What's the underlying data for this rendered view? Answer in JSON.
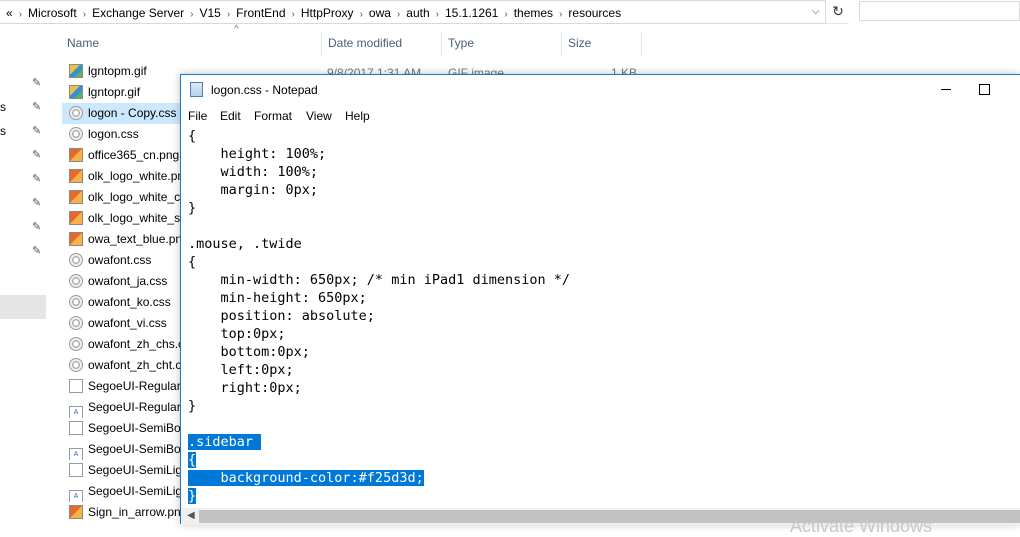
{
  "address": {
    "overflow": "«",
    "crumbs": [
      "Microsoft",
      "Exchange Server",
      "V15",
      "FrontEnd",
      "HttpProxy",
      "owa",
      "auth",
      "15.1.1261",
      "themes",
      "resources"
    ],
    "separator": "›",
    "dropdown_glyph": "⌵",
    "refresh_glyph": "↻"
  },
  "nav_fragments": [
    "s",
    "s"
  ],
  "columns": {
    "name": "Name",
    "date": "Date modified",
    "type": "Type",
    "size": "Size",
    "sort_glyph": "^"
  },
  "files": [
    {
      "name": "lgntopm.gif",
      "icon": "gif"
    },
    {
      "name": "lgntopr.gif",
      "icon": "gif"
    },
    {
      "name": "logon - Copy.css",
      "icon": "css",
      "selected": true
    },
    {
      "name": "logon.css",
      "icon": "css"
    },
    {
      "name": "office365_cn.png",
      "icon": "png"
    },
    {
      "name": "olk_logo_white.pn",
      "icon": "png"
    },
    {
      "name": "olk_logo_white_c",
      "icon": "png"
    },
    {
      "name": "olk_logo_white_s",
      "icon": "png"
    },
    {
      "name": "owa_text_blue.pn",
      "icon": "png"
    },
    {
      "name": "owafont.css",
      "icon": "css"
    },
    {
      "name": "owafont_ja.css",
      "icon": "css"
    },
    {
      "name": "owafont_ko.css",
      "icon": "css"
    },
    {
      "name": "owafont_vi.css",
      "icon": "css"
    },
    {
      "name": "owafont_zh_chs.c",
      "icon": "css"
    },
    {
      "name": "owafont_zh_cht.c",
      "icon": "css"
    },
    {
      "name": "SegoeUI-Regular.",
      "icon": "blank"
    },
    {
      "name": "SegoeUI-Regular.",
      "icon": "font"
    },
    {
      "name": "SegoeUI-SemiBol",
      "icon": "blank"
    },
    {
      "name": "SegoeUI-SemiBol",
      "icon": "font"
    },
    {
      "name": "SegoeUI-SemiLig",
      "icon": "blank"
    },
    {
      "name": "SegoeUI-SemiLig",
      "icon": "font"
    },
    {
      "name": "Sign_in_arrow.png",
      "icon": "png"
    }
  ],
  "hidden_row": {
    "date": "9/8/2017 1:31 AM",
    "type": "GIF image",
    "size": "1 KB"
  },
  "notepad": {
    "title": "logon.css - Notepad",
    "menu": [
      "File",
      "Edit",
      "Format",
      "View",
      "Help"
    ],
    "lines": [
      {
        "text": "{",
        "hl": false
      },
      {
        "text": "    height: 100%;",
        "hl": false
      },
      {
        "text": "    width: 100%;",
        "hl": false
      },
      {
        "text": "    margin: 0px;",
        "hl": false
      },
      {
        "text": "}",
        "hl": false
      },
      {
        "text": "",
        "hl": false
      },
      {
        "text": ".mouse, .twide",
        "hl": false
      },
      {
        "text": "{",
        "hl": false
      },
      {
        "text": "    min-width: 650px; /* min iPad1 dimension */",
        "hl": false
      },
      {
        "text": "    min-height: 650px;",
        "hl": false
      },
      {
        "text": "    position: absolute;",
        "hl": false
      },
      {
        "text": "    top:0px;",
        "hl": false
      },
      {
        "text": "    bottom:0px;",
        "hl": false
      },
      {
        "text": "    left:0px;",
        "hl": false
      },
      {
        "text": "    right:0px;",
        "hl": false
      },
      {
        "text": "}",
        "hl": false
      },
      {
        "text": "",
        "hl": false
      },
      {
        "text": ".sidebar ",
        "hl": true
      },
      {
        "text": "{",
        "hl": true
      },
      {
        "text": "    background-color:#f25d3d;",
        "hl": true
      },
      {
        "text": "}",
        "hl": true
      }
    ]
  },
  "watermark": "Activate Windows"
}
